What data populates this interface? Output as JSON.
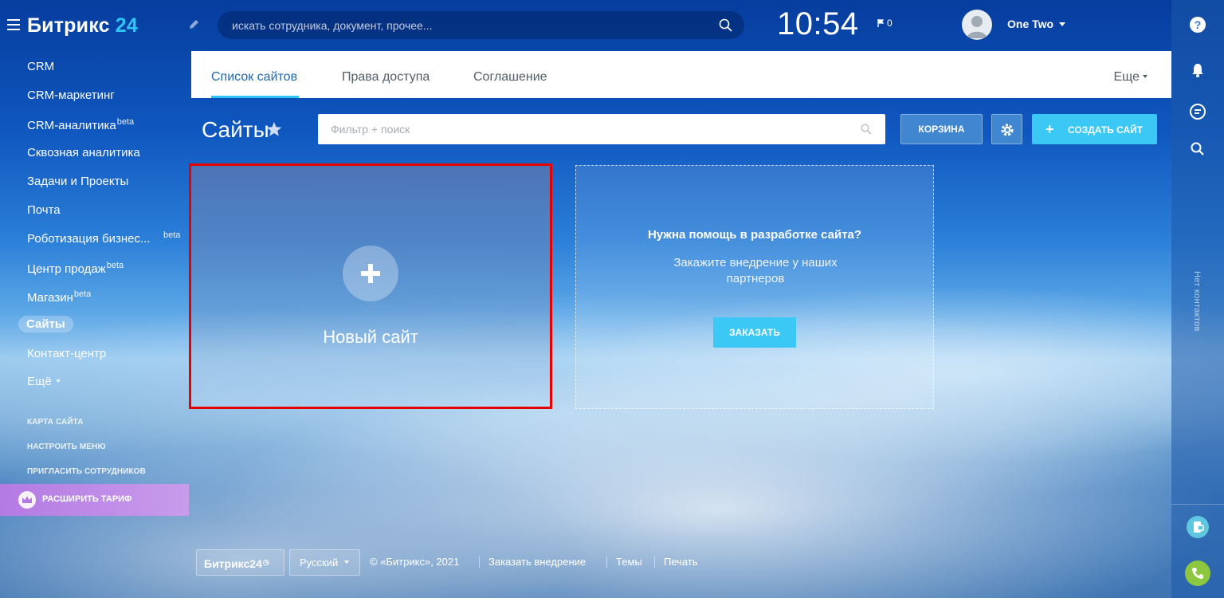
{
  "header": {
    "logo_main": "Битрикс",
    "logo_num": "24",
    "search_placeholder": "искать сотрудника, документ, прочее...",
    "clock": "10:54",
    "flag_count": "0",
    "user_name": "One Two"
  },
  "sidebar": {
    "items": [
      {
        "label": "CRM",
        "beta": ""
      },
      {
        "label": "CRM-маркетинг",
        "beta": ""
      },
      {
        "label": "CRM-аналитика",
        "beta": "beta"
      },
      {
        "label": "Сквозная аналитика",
        "beta": ""
      },
      {
        "label": "Задачи и Проекты",
        "beta": ""
      },
      {
        "label": "Почта",
        "beta": ""
      },
      {
        "label": "Роботизация бизнес...",
        "beta": "beta"
      },
      {
        "label": "Центр продаж",
        "beta": "beta"
      },
      {
        "label": "Магазин",
        "beta": "beta"
      },
      {
        "label": "Сайты",
        "beta": "",
        "active": true
      },
      {
        "label": "Контакт-центр",
        "beta": ""
      },
      {
        "label": "Ещё",
        "beta": ""
      }
    ],
    "links": [
      "Карта сайта",
      "Настроить меню",
      "Пригласить сотрудников"
    ],
    "upgrade_label": "РАСШИРИТЬ ТАРИФ"
  },
  "tabs": {
    "items": [
      "Список сайтов",
      "Права доступа",
      "Соглашение"
    ],
    "more": "Еще"
  },
  "toolbar": {
    "title": "Сайты",
    "filter_placeholder": "Фильтр + поиск",
    "trash_label": "КОРЗИНА",
    "create_label": "СОЗДАТЬ САЙТ"
  },
  "cards": {
    "new_site_label": "Новый сайт",
    "help_title": "Нужна помощь в разработке сайта?",
    "help_subtitle": "Закажите внедрение у наших партнеров",
    "order_label": "ЗАКАЗАТЬ"
  },
  "rightbar": {
    "vertical_text": "Нет контактов"
  },
  "footer": {
    "logo": "Битрикс24",
    "lang": "Русский",
    "copyright": "© «Битрикс», 2021",
    "order_link": "Заказать внедрение",
    "themes_link": "Темы",
    "print_link": "Печать"
  },
  "colors": {
    "accent": "#2fc6f6",
    "active_tab": "#2067b0",
    "button_primary": "#3bc8f5",
    "highlight_border": "#e60000",
    "upgrade_bg": "#b47ae3"
  }
}
